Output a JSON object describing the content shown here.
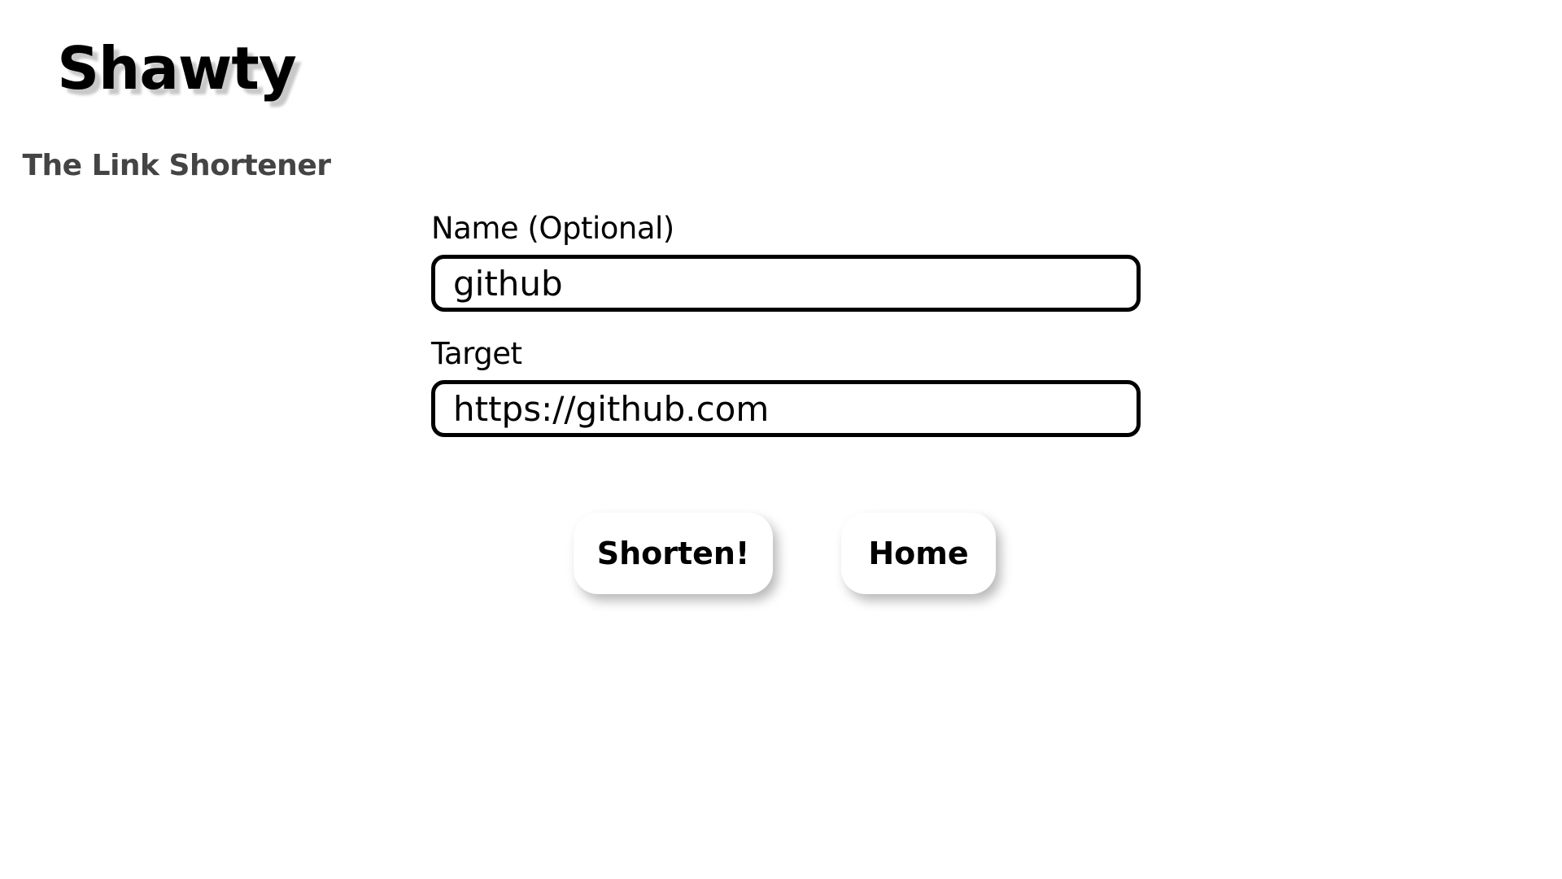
{
  "header": {
    "title": "Shawty",
    "subtitle": "The Link Shortener"
  },
  "form": {
    "name_field": {
      "label": "Name (Optional)",
      "value": "github"
    },
    "target_field": {
      "label": "Target",
      "value": "https://github.com"
    }
  },
  "actions": {
    "shorten_label": "Shorten!",
    "home_label": "Home"
  },
  "colors": {
    "background": "#ffffff",
    "text": "#000000",
    "subtitle": "#444444",
    "title_shadow": "#c8c8c8"
  }
}
